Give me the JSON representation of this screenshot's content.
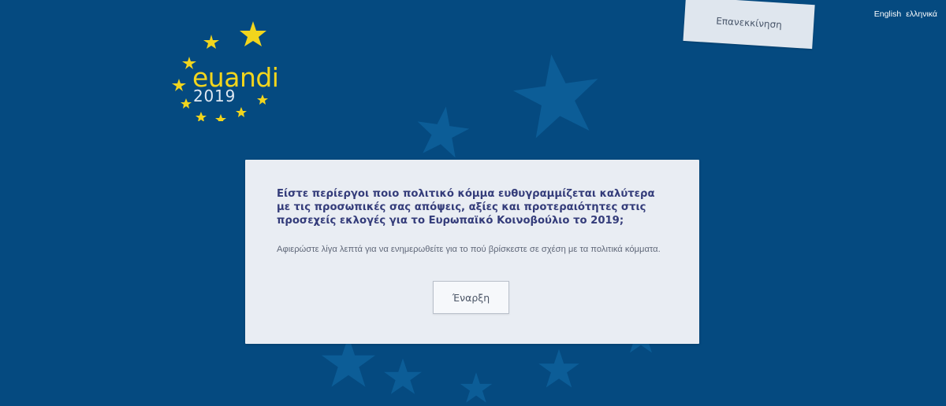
{
  "header": {
    "restart_label": "Επανεκκίνηση",
    "language_options": [
      "English",
      "ελληνικά"
    ]
  },
  "logo": {
    "brand_name": "euandi",
    "year": "2019"
  },
  "intro_card": {
    "question": "Είστε περίεργοι ποιο πολιτικό κόμμα ευθυγραμμίζεται καλύτερα με τις προσωπικές σας απόψεις, αξίες και προτεραιότητες στις προσεχείς εκλογές για το Ευρωπαϊκό Κοινοβούλιο το 2019;",
    "description": "Αφιερώστε λίγα λεπτά για να ενημερωθείτε για το πού βρίσκεστε σε σχέση με τα πολιτικά κόμματα.",
    "start_label": "Έναρξη"
  },
  "colors": {
    "background": "#054a80",
    "background_star": "#0d5f99",
    "logo_yellow": "#f2d51d",
    "card_background": "#e9edf3",
    "question_text": "#343c7a",
    "description_text": "#606879"
  },
  "icons": {
    "logo_decoration": "yellow-star-ring-icon",
    "background_decoration": "decorative-star-icon"
  }
}
